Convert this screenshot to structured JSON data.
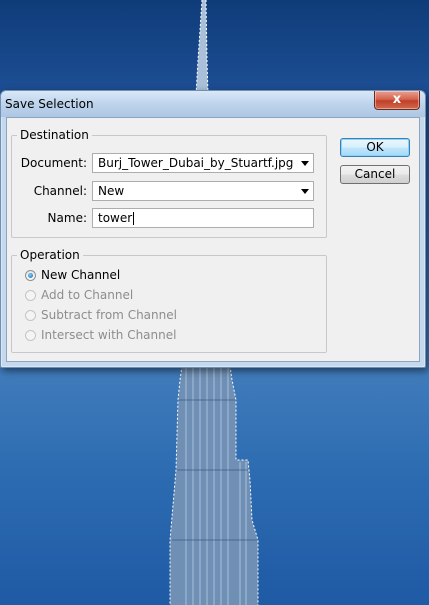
{
  "dialog": {
    "title": "Save Selection",
    "close_glyph": "x",
    "destination": {
      "legend": "Destination",
      "document_label": "Document:",
      "document_value": "Burj_Tower_Dubai_by_Stuartf.jpg",
      "channel_label": "Channel:",
      "channel_value": "New",
      "name_label": "Name:",
      "name_value": "tower"
    },
    "operation": {
      "legend": "Operation",
      "options": [
        {
          "label": "New Channel",
          "checked": true,
          "enabled": true
        },
        {
          "label": "Add to Channel",
          "checked": false,
          "enabled": false
        },
        {
          "label": "Subtract from Channel",
          "checked": false,
          "enabled": false
        },
        {
          "label": "Intersect with Channel",
          "checked": false,
          "enabled": false
        }
      ]
    },
    "buttons": {
      "ok": "OK",
      "cancel": "Cancel"
    }
  }
}
